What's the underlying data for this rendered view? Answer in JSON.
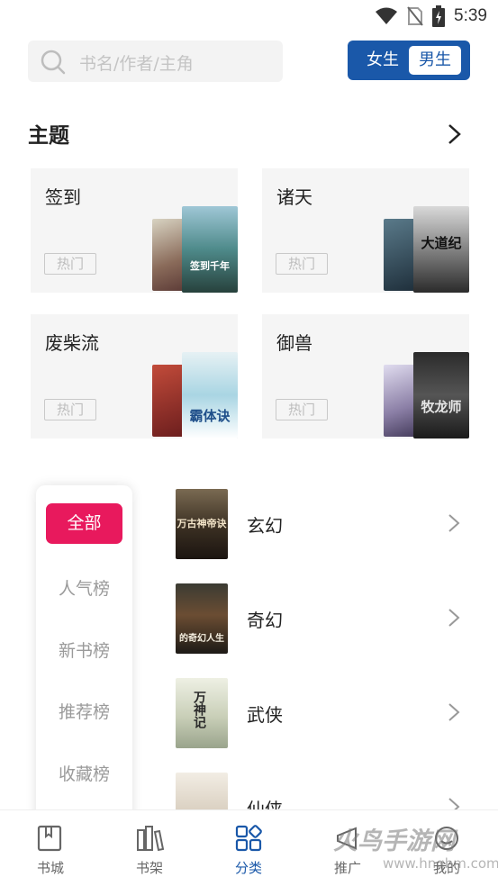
{
  "status_bar": {
    "time": "5:39",
    "icons": [
      "wifi-icon",
      "no-sim-icon",
      "battery-charging-icon"
    ]
  },
  "search": {
    "placeholder": "书名/作者/主角",
    "icon": "search-icon"
  },
  "gender_toggle": {
    "female": "女生",
    "male": "男生",
    "selected": "男生",
    "accent": "#1a58a9"
  },
  "topics": {
    "title": "主题",
    "cards": [
      {
        "title": "签到",
        "tag": "热门",
        "covers": [
          "",
          "签到千年"
        ]
      },
      {
        "title": "诸天",
        "tag": "热门",
        "covers": [
          "",
          "大道纪"
        ]
      },
      {
        "title": "废柴流",
        "tag": "热门",
        "covers": [
          "",
          "霸体诀"
        ]
      },
      {
        "title": "御兽",
        "tag": "热门",
        "covers": [
          "",
          "牧龙师"
        ]
      }
    ]
  },
  "categories": {
    "items": [
      "全部",
      "人气榜",
      "新书榜",
      "推荐榜",
      "收藏榜"
    ],
    "selected": "全部",
    "accent": "#e8195d"
  },
  "genres": [
    {
      "label": "玄幻",
      "cover_text": "万古神帝诀"
    },
    {
      "label": "奇幻",
      "cover_text": "的奇幻人生"
    },
    {
      "label": "武侠",
      "cover_text": "万神记"
    },
    {
      "label": "仙侠",
      "cover_text": ""
    }
  ],
  "bottom_nav": {
    "items": [
      {
        "label": "书城",
        "icon": "book-icon"
      },
      {
        "label": "书架",
        "icon": "bookshelf-icon"
      },
      {
        "label": "分类",
        "icon": "category-grid-icon"
      },
      {
        "label": "推广",
        "icon": "promote-icon"
      },
      {
        "label": "我的",
        "icon": "profile-icon"
      }
    ],
    "active": "分类"
  },
  "watermark": {
    "text": "火鸟手游网",
    "url": "www.hnqbm.com"
  }
}
